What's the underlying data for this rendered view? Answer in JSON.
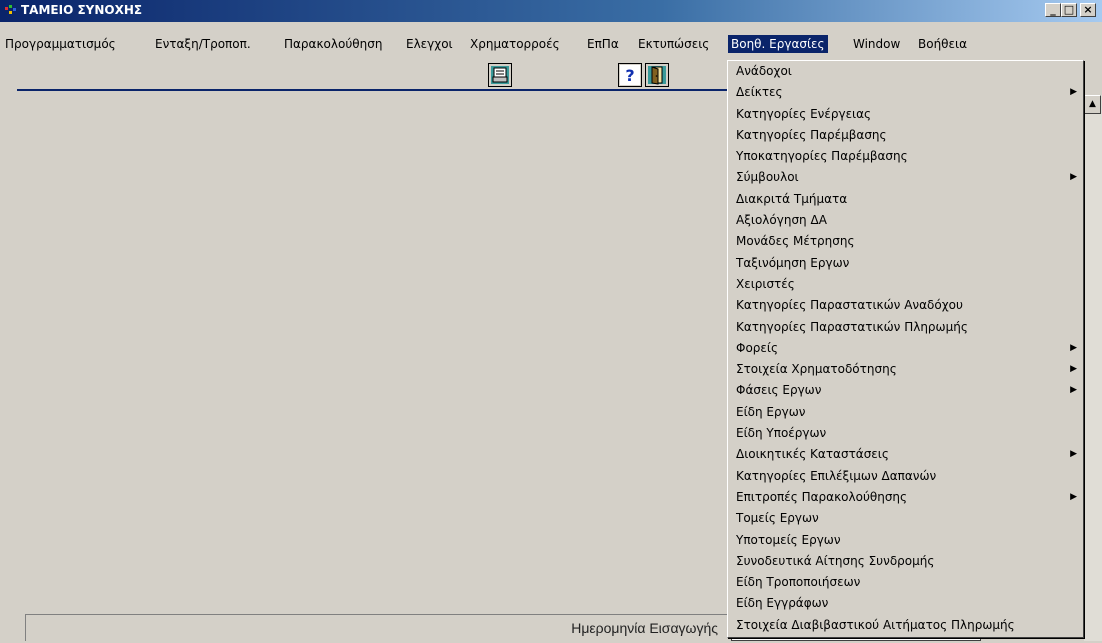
{
  "window": {
    "title": "ΤΑΜΕΙΟ ΣΥΝΟΧΗΣ",
    "min": "_",
    "max": "□",
    "close": "×"
  },
  "menubar": {
    "items": [
      "Προγραμματισμός",
      "Ενταξη/Τροποπ.",
      "Παρακολούθηση",
      "Ελεγχοι",
      "Χρηματορροές",
      "ΕπΠα",
      "Εκτυπώσεις",
      "Βοηθ. Εργασίες",
      "Window",
      "Βοήθεια"
    ]
  },
  "toolbar": {
    "icons": [
      "print-icon",
      "help-icon",
      "exit-door-icon"
    ]
  },
  "dropdown": {
    "items": [
      {
        "label": "Ανάδοχοι",
        "submenu": false
      },
      {
        "label": "Δείκτες",
        "submenu": true
      },
      {
        "label": "Κατηγορίες Ενέργειας",
        "submenu": false
      },
      {
        "label": "Κατηγορίες Παρέμβασης",
        "submenu": false
      },
      {
        "label": "Υποκατηγορίες Παρέμβασης",
        "submenu": false
      },
      {
        "label": "Σύμβουλοι",
        "submenu": true
      },
      {
        "label": "Διακριτά Τμήματα",
        "submenu": false
      },
      {
        "label": "Αξιολόγηση ΔΑ",
        "submenu": false
      },
      {
        "label": "Μονάδες Μέτρησης",
        "submenu": false
      },
      {
        "label": "Ταξινόμηση Εργων",
        "submenu": false
      },
      {
        "label": "Χειριστές",
        "submenu": false
      },
      {
        "label": "Κατηγορίες Παραστατικών Αναδόχου",
        "submenu": false
      },
      {
        "label": "Κατηγορίες Παραστατικών Πληρωμής",
        "submenu": false
      },
      {
        "label": "Φορείς",
        "submenu": true
      },
      {
        "label": "Στοιχεία Χρηματοδότησης",
        "submenu": true
      },
      {
        "label": "Φάσεις Εργων",
        "submenu": true
      },
      {
        "label": "Είδη Εργων",
        "submenu": false
      },
      {
        "label": "Είδη Υποέργων",
        "submenu": false
      },
      {
        "label": "Διοικητικές Καταστάσεις",
        "submenu": true
      },
      {
        "label": "Κατηγορίες Επιλέξιμων Δαπανών",
        "submenu": false
      },
      {
        "label": "Επιτροπές Παρακολούθησης",
        "submenu": true
      },
      {
        "label": "Τομείς Εργων",
        "submenu": false
      },
      {
        "label": "Υποτομείς Εργων",
        "submenu": false
      },
      {
        "label": "Συνοδευτικά Αίτησης Συνδρομής",
        "submenu": false
      },
      {
        "label": "Είδη Τροποποιήσεων",
        "submenu": false
      },
      {
        "label": "Είδη Εγγράφων",
        "submenu": false
      },
      {
        "label": "Στοιχεία Διαβιβαστικού Αιτήματος Πληρωμής",
        "submenu": false
      }
    ]
  },
  "status": {
    "label": "Ημερομηνία Εισαγωγής",
    "value": ""
  }
}
